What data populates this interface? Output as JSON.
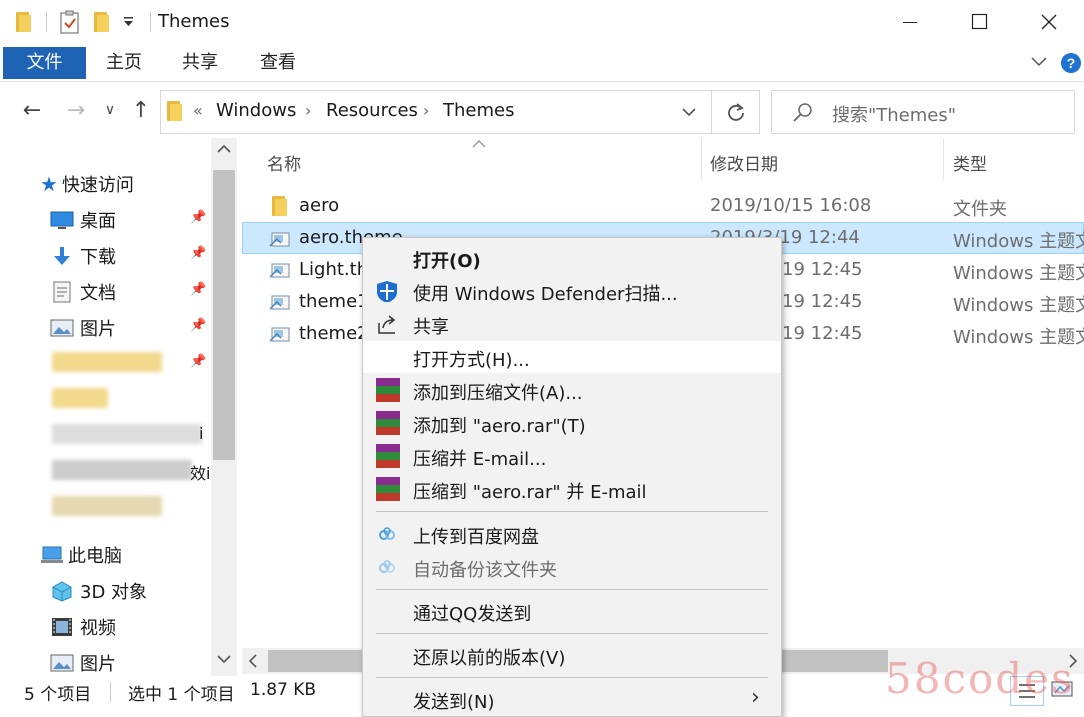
{
  "window": {
    "title": "Themes",
    "controls": {
      "minimize": "—",
      "maximize": "☐",
      "close": "✕"
    }
  },
  "ribbon": {
    "tabs": [
      "文件",
      "主页",
      "共享",
      "查看"
    ],
    "active_tab": "文件",
    "accent_color": "#1e63b4"
  },
  "navigation": {
    "back": "←",
    "forward": "→",
    "recent": "∨",
    "up": "↑",
    "breadcrumb_overflow": "«",
    "breadcrumb": [
      "Windows",
      "Resources",
      "Themes"
    ],
    "search_placeholder": "搜索\"Themes\""
  },
  "sidebar": {
    "quick_access": "快速访问",
    "pinned": [
      {
        "label": "桌面",
        "icon": "desktop-icon"
      },
      {
        "label": "下载",
        "icon": "download-icon"
      },
      {
        "label": "文档",
        "icon": "documents-icon"
      },
      {
        "label": "图片",
        "icon": "pictures-icon"
      }
    ],
    "partial_labels": [
      "i",
      "效i"
    ],
    "this_pc": "此电脑",
    "pc_items": [
      {
        "label": "3D 对象",
        "icon": "3d-objects-icon"
      },
      {
        "label": "视频",
        "icon": "videos-icon"
      },
      {
        "label": "图片",
        "icon": "pictures-icon"
      }
    ]
  },
  "file_list": {
    "columns": [
      "名称",
      "修改日期",
      "类型"
    ],
    "rows": [
      {
        "name": "aero",
        "date": "2019/10/15 16:08",
        "type": "文件夹",
        "icon": "folder-icon",
        "selected": false
      },
      {
        "name": "aero.theme",
        "date": "2019/3/19 12:44",
        "type": "Windows 主题文",
        "icon": "theme-file-icon",
        "selected": true
      },
      {
        "name": "Light.th",
        "date": "19 12:45",
        "type": "Windows 主题文",
        "icon": "theme-file-icon",
        "selected": false
      },
      {
        "name": "theme1",
        "date": "19 12:45",
        "type": "Windows 主题文",
        "icon": "theme-file-icon",
        "selected": false
      },
      {
        "name": "theme2",
        "date": "19 12:45",
        "type": "Windows 主题文",
        "icon": "theme-file-icon",
        "selected": false
      }
    ]
  },
  "context_menu": {
    "items": [
      {
        "label": "打开(O)",
        "icon": "",
        "bold": true
      },
      {
        "label": "使用 Windows Defender扫描...",
        "icon": "defender-shield-icon"
      },
      {
        "label": "共享",
        "icon": "share-icon"
      },
      {
        "label": "打开方式(H)...",
        "icon": "",
        "highlighted": true
      },
      {
        "label": "添加到压缩文件(A)...",
        "icon": "winrar-icon"
      },
      {
        "label": "添加到 \"aero.rar\"(T)",
        "icon": "winrar-icon"
      },
      {
        "label": "压缩并 E-mail...",
        "icon": "winrar-icon"
      },
      {
        "label": "压缩到 \"aero.rar\" 并 E-mail",
        "icon": "winrar-icon"
      },
      {
        "label": "上传到百度网盘",
        "icon": "baidu-netdisk-icon"
      },
      {
        "label": "自动备份该文件夹",
        "icon": "baidu-netdisk-icon",
        "disabled": true
      },
      {
        "label": "通过QQ发送到",
        "icon": ""
      },
      {
        "label": "还原以前的版本(V)",
        "icon": ""
      },
      {
        "label": "发送到(N)",
        "icon": "",
        "submenu": true
      }
    ],
    "submenu_arrow": "›"
  },
  "status_bar": {
    "item_count": "5 个项目",
    "selection": "选中 1 个项目",
    "size": "1.87 KB"
  },
  "watermark": "58codes"
}
